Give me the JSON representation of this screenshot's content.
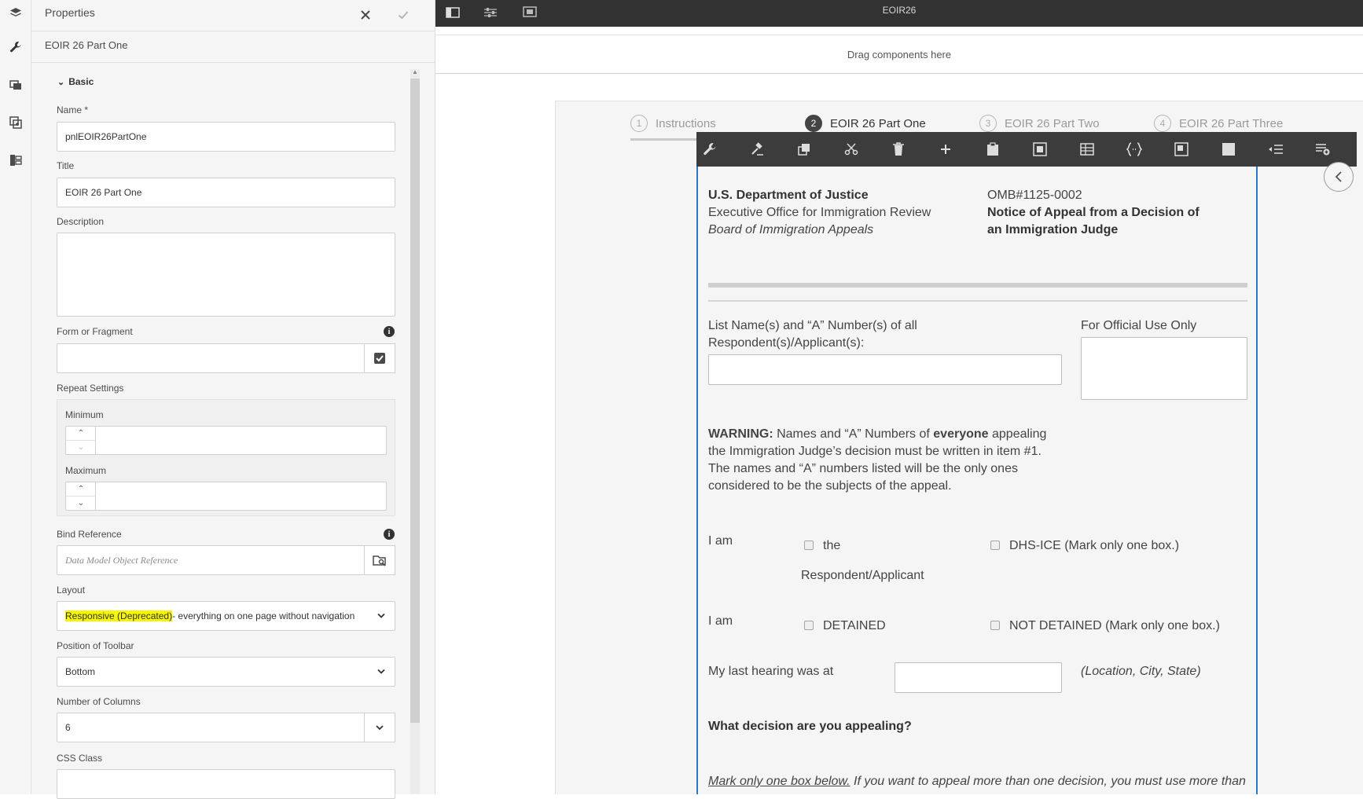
{
  "properties_panel": {
    "title": "Properties",
    "subtitle": "EOIR 26 Part One",
    "section": "Basic",
    "fields": {
      "name_label": "Name *",
      "name_value": "pnlEOIR26PartOne",
      "title_label": "Title",
      "title_value": "EOIR 26 Part One",
      "description_label": "Description",
      "description_value": "",
      "form_fragment_label": "Form or Fragment",
      "repeat_label": "Repeat Settings",
      "minimum_label": "Minimum",
      "maximum_label": "Maximum",
      "bind_label": "Bind Reference",
      "bind_placeholder": "Data Model Object Reference",
      "layout_label": "Layout",
      "layout_highlight": "Responsive (Deprecated)",
      "layout_rest": " - everything on one page without navigation",
      "toolbar_label": "Position of Toolbar",
      "toolbar_value": "Bottom",
      "columns_label": "Number of Columns",
      "columns_value": "6",
      "css_label": "CSS Class"
    }
  },
  "editor": {
    "document_name": "EOIR26",
    "dropzone": "Drag components here",
    "wizard_tabs": [
      {
        "num": "1",
        "label": "Instructions"
      },
      {
        "num": "2",
        "label": "EOIR 26 Part One"
      },
      {
        "num": "3",
        "label": "EOIR 26 Part Two"
      },
      {
        "num": "4",
        "label": "EOIR 26 Part Three"
      }
    ]
  },
  "form": {
    "dept": "U.S. Department of Justice",
    "office": "Executive Office for Immigration Review",
    "board": "Board of Immigration Appeals",
    "omb": "OMB#1125-0002",
    "notice_line1": "Notice of Appeal from a Decision of",
    "notice_line2": "an Immigration Judge",
    "list_names_line1": "List Name(s) and “A” Number(s) of all",
    "list_names_line2": "Respondent(s)/Applicant(s):",
    "official_use": "For Official Use Only",
    "warning_bold": "WARNING:",
    "warning_p1": " Names and “A” Numbers of ",
    "warning_everyone": "everyone",
    "warning_p2": " appealing",
    "warning_line2": "the Immigration Judge’s decision must be written in item #1.",
    "warning_line3": "The names and “A” numbers listed will be the only ones",
    "warning_line4": "considered to be the subjects of the appeal.",
    "i_am_1": "I am",
    "opt_the": "the",
    "opt_resp": "Respondent/Applicant",
    "opt_dhs": "DHS-ICE (Mark only one box.)",
    "i_am_2": "I am",
    "opt_detained": "DETAINED",
    "opt_not_detained": "NOT DETAINED (Mark only one box.)",
    "last_hearing": "My last hearing was at",
    "location_hint": "(Location, City, State)",
    "decision_q": "What decision are you appealing?",
    "mark_only": "Mark only one box below.",
    "mark_rest": " If you want to appeal more than one decision, you must use more than"
  }
}
